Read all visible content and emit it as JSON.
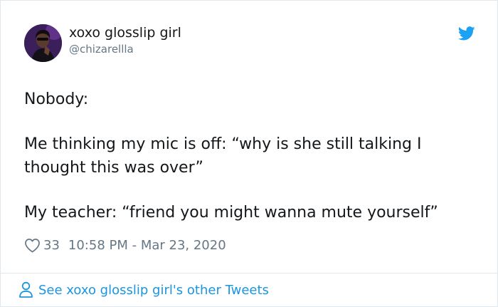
{
  "author": {
    "display_name": "xoxo glosslip girl",
    "handle": "@chizarellla",
    "avatar_icon": "user-avatar"
  },
  "brand": {
    "icon": "twitter-bird-icon",
    "color": "#1da1f2"
  },
  "tweet": {
    "lines": [
      "Nobody:",
      "Me thinking my mic is off: “why is she still talking I",
      "thought this was over”",
      "My teacher: “friend you might wanna mute yourself”"
    ]
  },
  "meta": {
    "like_icon": "heart-icon",
    "like_count": "33",
    "timestamp": "10:58 PM - Mar 23, 2020"
  },
  "footer": {
    "icon": "person-icon",
    "link_text": "See xoxo glosslip girl's other Tweets",
    "link_color": "#1b95e0"
  },
  "colors": {
    "text": "#14171a",
    "secondary": "#657786",
    "border": "#e1e8ed"
  }
}
